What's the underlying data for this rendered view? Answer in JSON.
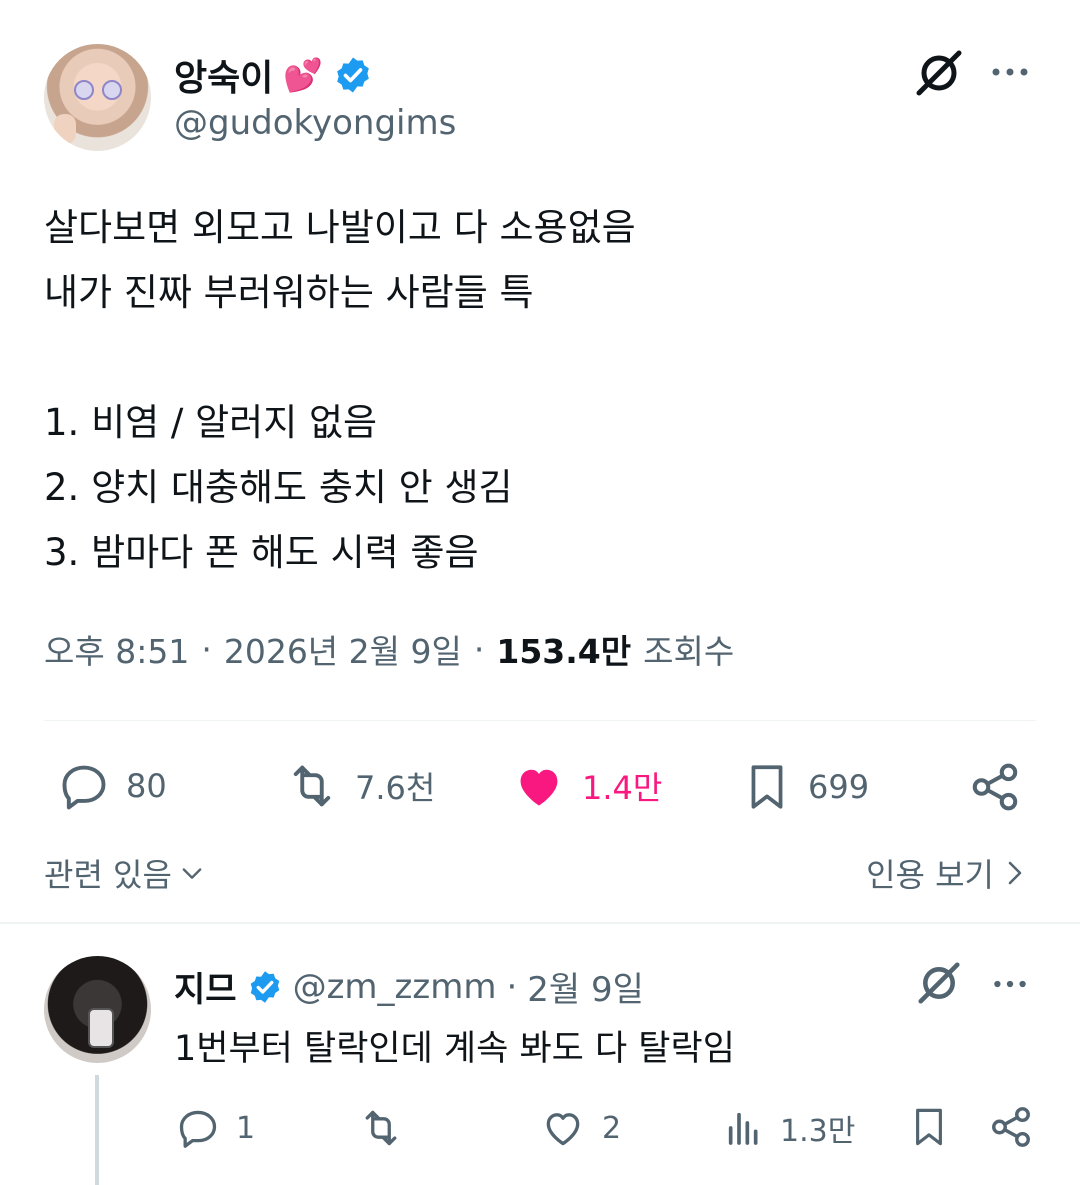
{
  "tweet": {
    "author": {
      "display_name": "앙숙이",
      "name_emoji": "💕",
      "handle": "@gudokyongims",
      "verified": true
    },
    "text": "살다보면 외모고 나발이고 다 소용없음\n내가 진짜 부러워하는 사람들 특\n\n1. 비염 / 알러지 없음\n2. 양치 대충해도 충치 안 생김\n3. 밤마다 폰 해도 시력 좋음",
    "time": "오후 8:51",
    "date": "2026년 2월 9일",
    "views_count": "153.4만",
    "views_label": "조회수",
    "actions": {
      "replies": "80",
      "retweets": "7.6천",
      "likes": "1.4만",
      "bookmarks": "699"
    },
    "related_label": "관련 있음",
    "quotes_label": "인용 보기"
  },
  "reply": {
    "display_name": "지므",
    "handle": "@zm_zzmm",
    "date": "2월 9일",
    "text": "1번부터 탈락인데 계속 봐도 다 탈락임",
    "actions": {
      "replies": "1",
      "likes": "2",
      "views": "1.3만"
    }
  },
  "colors": {
    "accent_blue": "#1d9bf0",
    "like_pink": "#f91880",
    "secondary_text": "#536471",
    "primary_text": "#0f1419"
  },
  "icons": [
    "verified-badge-icon",
    "grok-icon",
    "more-icon",
    "reply-icon",
    "retweet-icon",
    "like-icon",
    "bookmark-icon",
    "share-icon",
    "chevron-down-icon",
    "chevron-right-icon",
    "views-icon"
  ]
}
